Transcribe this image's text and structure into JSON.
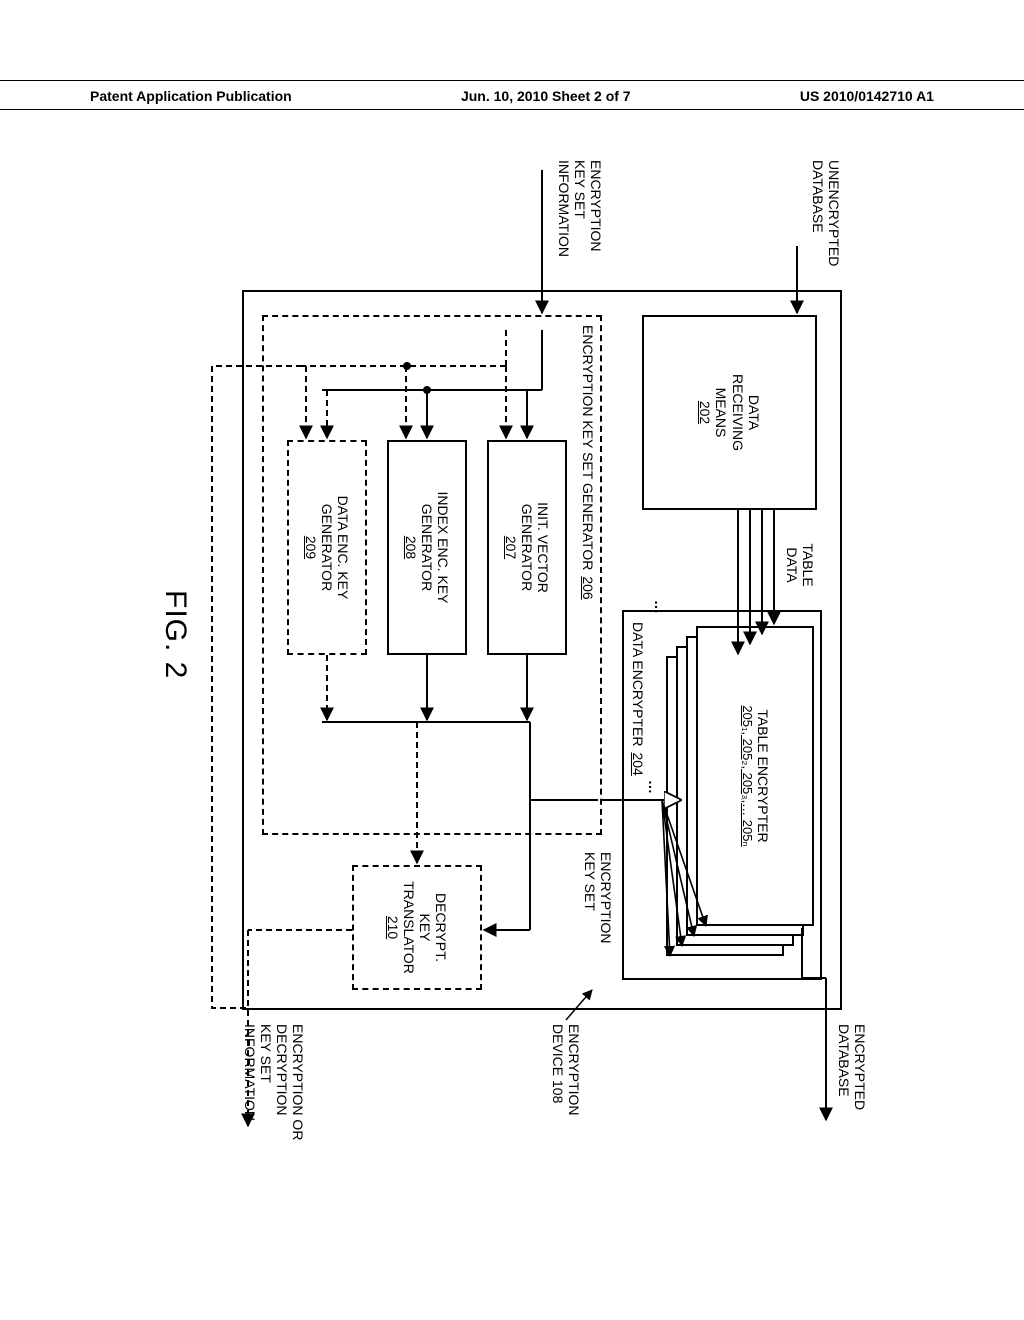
{
  "header": {
    "left": "Patent Application Publication",
    "center": "Jun. 10, 2010  Sheet 2 of 7",
    "right": "US 2010/0142710 A1"
  },
  "labels": {
    "input_db": "UNENCRYPTED\nDATABASE",
    "input_keyset": "ENCRYPTION\nKEY SET\nINFORMATION",
    "output_db": "ENCRYPTED\nDATABASE",
    "output_keyset": "ENCRYPTION OR\nDECRYPTION\nKEY SET\nINFORMATION",
    "device_label": "ENCRYPTION\nDEVICE  108",
    "table_data": "TABLE\nDATA",
    "encryption_key_set": "ENCRYPTION\nKEY SET",
    "figure": "FIG. 2"
  },
  "boxes": {
    "data_receiving": {
      "title": "DATA\nRECEIVING\nMEANS",
      "ref": "202"
    },
    "data_encrypter": {
      "title": "DATA ENCRYPTER",
      "ref": "204"
    },
    "table_encrypter": {
      "title": "TABLE ENCRYPTER",
      "refs": "205₁, 205₂, 205₃,… 205ₙ"
    },
    "keyset_gen": {
      "title": "ENCRYPTION KEY SET GENERATOR",
      "ref": "206"
    },
    "init_vec": {
      "title": "INIT. VECTOR\nGENERATOR",
      "ref": "207"
    },
    "index_key": {
      "title": "INDEX ENC. KEY\nGENERATOR",
      "ref": "208"
    },
    "data_key": {
      "title": "DATA ENC. KEY\nGENERATOR",
      "ref": "209"
    },
    "decrypt_trans": {
      "title": "DECRYPT.\nKEY\nTRANSLATOR",
      "ref": "210"
    }
  }
}
